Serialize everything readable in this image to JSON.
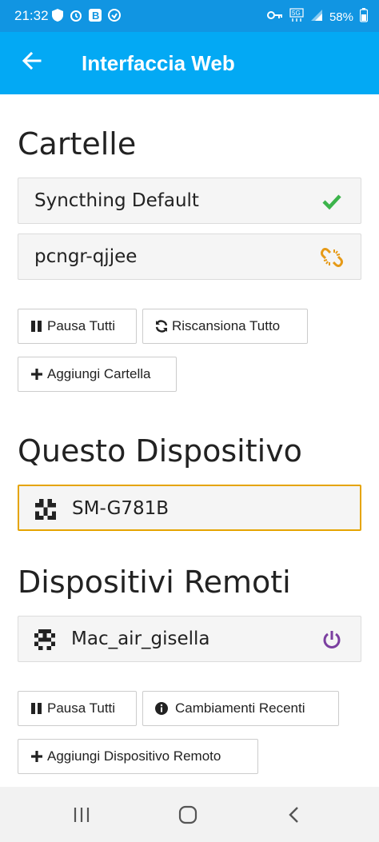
{
  "status_bar": {
    "time": "21:32",
    "battery": "58%",
    "icons_left": [
      "shield-icon",
      "alarm-icon",
      "b-app-icon",
      "sync-icon"
    ],
    "icons_right": [
      "key-icon",
      "5g-icon",
      "signal-icon",
      "battery-icon"
    ]
  },
  "app_bar": {
    "title": "Interfaccia Web"
  },
  "folders": {
    "heading": "Cartelle",
    "items": [
      {
        "label": "Syncthing Default",
        "status_icon": "check-icon"
      },
      {
        "label": "pcngr-qjjee",
        "status_icon": "broken-link-icon"
      }
    ],
    "buttons": {
      "pause_all": "Pausa Tutti",
      "rescan_all": "Riscansiona Tutto",
      "add_folder": "Aggiungi Cartella"
    }
  },
  "this_device": {
    "heading": "Questo Dispositivo",
    "name": "SM-G781B"
  },
  "remote_devices": {
    "heading": "Dispositivi Remoti",
    "items": [
      {
        "label": "Mac_air_gisella",
        "status_icon": "power-icon"
      }
    ],
    "buttons": {
      "pause_all": "Pausa Tutti",
      "recent_changes": "Cambiamenti Recenti",
      "add_remote": "Aggiungi Dispositivo Remoto"
    }
  },
  "colors": {
    "status_bar": "#1195e2",
    "app_bar": "#03a9f4",
    "check": "#3cb44b",
    "warning": "#e69a17",
    "power": "#7b3fa0",
    "highlight_border": "#e5a400"
  }
}
